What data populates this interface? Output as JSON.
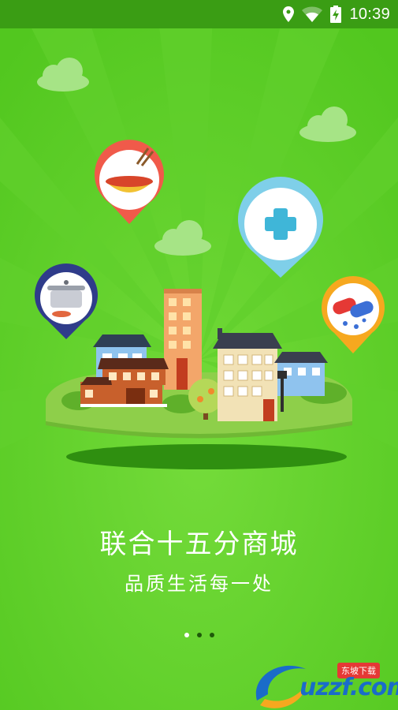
{
  "status_bar": {
    "time": "10:39",
    "icons": [
      "location-icon",
      "wifi-icon",
      "battery-charging-icon"
    ]
  },
  "splash": {
    "title": "联合十五分商城",
    "subtitle": "品质生活每一处",
    "pagination": {
      "total": 3,
      "current": 1
    }
  },
  "illustration": {
    "pins": [
      "noodle-bowl-icon",
      "medical-cross-icon",
      "cooking-pot-icon",
      "medicine-pills-icon"
    ]
  },
  "watermark": {
    "text": "uzzf.com",
    "tag": "东坡下载"
  },
  "colors": {
    "background": "#52c71f",
    "status_bar": "#3a9d14",
    "island": "#8ecf4a",
    "shadow": "#2f8f10"
  }
}
